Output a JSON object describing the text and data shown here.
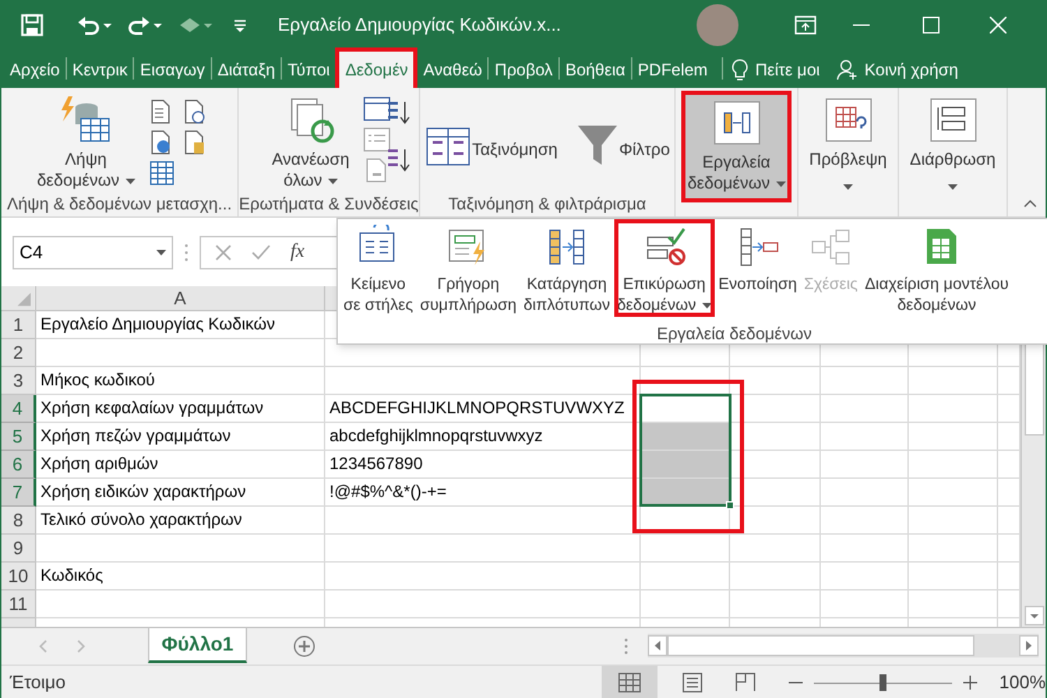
{
  "title_bar": {
    "title": "Εργαλείο Δημιουργίας Κωδικών.x..."
  },
  "ribbon_tabs": [
    {
      "label": "Αρχείο",
      "selected": false,
      "highlighted": false
    },
    {
      "label": "Κεντρικ",
      "selected": false,
      "highlighted": false
    },
    {
      "label": "Εισαγωγ",
      "selected": false,
      "highlighted": false
    },
    {
      "label": "Διάταξη",
      "selected": false,
      "highlighted": false
    },
    {
      "label": "Τύποι",
      "selected": false,
      "highlighted": false
    },
    {
      "label": "Δεδομέν",
      "selected": true,
      "highlighted": true
    },
    {
      "label": "Αναθεώ",
      "selected": false,
      "highlighted": false
    },
    {
      "label": "Προβολ",
      "selected": false,
      "highlighted": false
    },
    {
      "label": "Βοήθεια",
      "selected": false,
      "highlighted": false
    },
    {
      "label": "PDFelem",
      "selected": false,
      "highlighted": false
    }
  ],
  "tell_me": "Πείτε μοι",
  "share": "Κοινή χρήση",
  "ribbon_groups": [
    {
      "kind": "get_data",
      "label": "Λήψη & δεδομένων μετασχη...",
      "buttons": [
        {
          "label": "Λήψη\nδεδομένων",
          "dropdown": true,
          "pressed": false,
          "highlighted": false
        }
      ]
    },
    {
      "kind": "queries",
      "label": "Ερωτήματα & Συνδέσεις",
      "buttons": [
        {
          "label": "Ανανέωση\nόλων",
          "dropdown": true,
          "pressed": false,
          "highlighted": false
        }
      ]
    },
    {
      "kind": "sort_filter",
      "label": "Ταξινόμηση & φιλτράρισμα",
      "buttons": [
        {
          "label": "Ταξινόμηση",
          "dropdown": false,
          "pressed": false,
          "highlighted": false
        },
        {
          "label": "Φίλτρο",
          "dropdown": false,
          "pressed": false,
          "highlighted": false
        }
      ]
    },
    {
      "kind": "tools",
      "buttons": [
        {
          "label": "Εργαλεία\nδεδομένων",
          "dropdown": true,
          "pressed": true,
          "highlighted": true
        }
      ]
    },
    {
      "kind": "forecast",
      "buttons": [
        {
          "label": "Πρόβλεψη",
          "dropdown": true,
          "pressed": false,
          "highlighted": false
        }
      ]
    },
    {
      "kind": "outline",
      "buttons": [
        {
          "label": "Διάρθρωση",
          "dropdown": true,
          "pressed": false,
          "highlighted": false
        }
      ]
    }
  ],
  "data_tools_menu": {
    "label": "Εργαλεία δεδομένων",
    "buttons": [
      {
        "kind": "text_to_columns",
        "label": "Κείμενο\nσε στήλες",
        "dropdown": false,
        "disabled": false,
        "highlighted": false
      },
      {
        "kind": "flash_fill",
        "label": "Γρήγορη\nσυμπλήρωση",
        "dropdown": false,
        "disabled": false,
        "highlighted": false
      },
      {
        "kind": "remove_duplicates",
        "label": "Κατάργηση\nδιπλότυπων",
        "dropdown": false,
        "disabled": false,
        "highlighted": false
      },
      {
        "kind": "validation",
        "label": "Επικύρωση\nδεδομένων",
        "dropdown": true,
        "disabled": false,
        "highlighted": true
      },
      {
        "kind": "consolidate",
        "label": "Ενοποίηση",
        "dropdown": false,
        "disabled": false,
        "highlighted": false
      },
      {
        "kind": "relationships",
        "label": "Σχέσεις",
        "dropdown": false,
        "disabled": true,
        "highlighted": false
      },
      {
        "kind": "data_model",
        "label": "Διαχείριση μοντέλου\nδεδομένων",
        "dropdown": false,
        "disabled": false,
        "highlighted": false
      }
    ]
  },
  "formula_bar": {
    "name_box": "C4",
    "function_label": "fx"
  },
  "sheet": {
    "columns": [
      "A"
    ],
    "selection_highlighted": true,
    "rows": [
      {
        "number": "1",
        "selected": false,
        "cells": [
          "Εργαλείο Δημιουργίας Κωδικών",
          ""
        ]
      },
      {
        "number": "2",
        "selected": false,
        "cells": [
          "",
          ""
        ]
      },
      {
        "number": "3",
        "selected": false,
        "cells": [
          "Μήκος κωδικού",
          ""
        ]
      },
      {
        "number": "4",
        "selected": true,
        "cells": [
          "Χρήση κεφαλαίων γραμμάτων",
          "ABCDEFGHIJKLMNOPQRSTUVWXYZ"
        ]
      },
      {
        "number": "5",
        "selected": true,
        "cells": [
          "Χρήση πεζών γραμμάτων",
          "abcdefghijklmnopqrstuvwxyz"
        ]
      },
      {
        "number": "6",
        "selected": true,
        "cells": [
          "Χρήση αριθμών",
          "1234567890"
        ]
      },
      {
        "number": "7",
        "selected": true,
        "cells": [
          "Χρήση ειδικών χαρακτήρων",
          "!@#$%^&*()-+="
        ]
      },
      {
        "number": "8",
        "selected": false,
        "cells": [
          "Τελικό σύνολο χαρακτήρων",
          ""
        ]
      },
      {
        "number": "9",
        "selected": false,
        "cells": [
          "",
          ""
        ]
      },
      {
        "number": "10",
        "selected": false,
        "cells": [
          "Κωδικός",
          ""
        ]
      },
      {
        "number": "11",
        "selected": false,
        "cells": [
          "",
          ""
        ]
      }
    ]
  },
  "sheet_tabs": [
    {
      "label": "Φύλλο1",
      "selected": true
    }
  ],
  "status_bar": {
    "status": "Έτοιμο",
    "zoom": {
      "level": 0.5,
      "reading": "100%"
    }
  }
}
